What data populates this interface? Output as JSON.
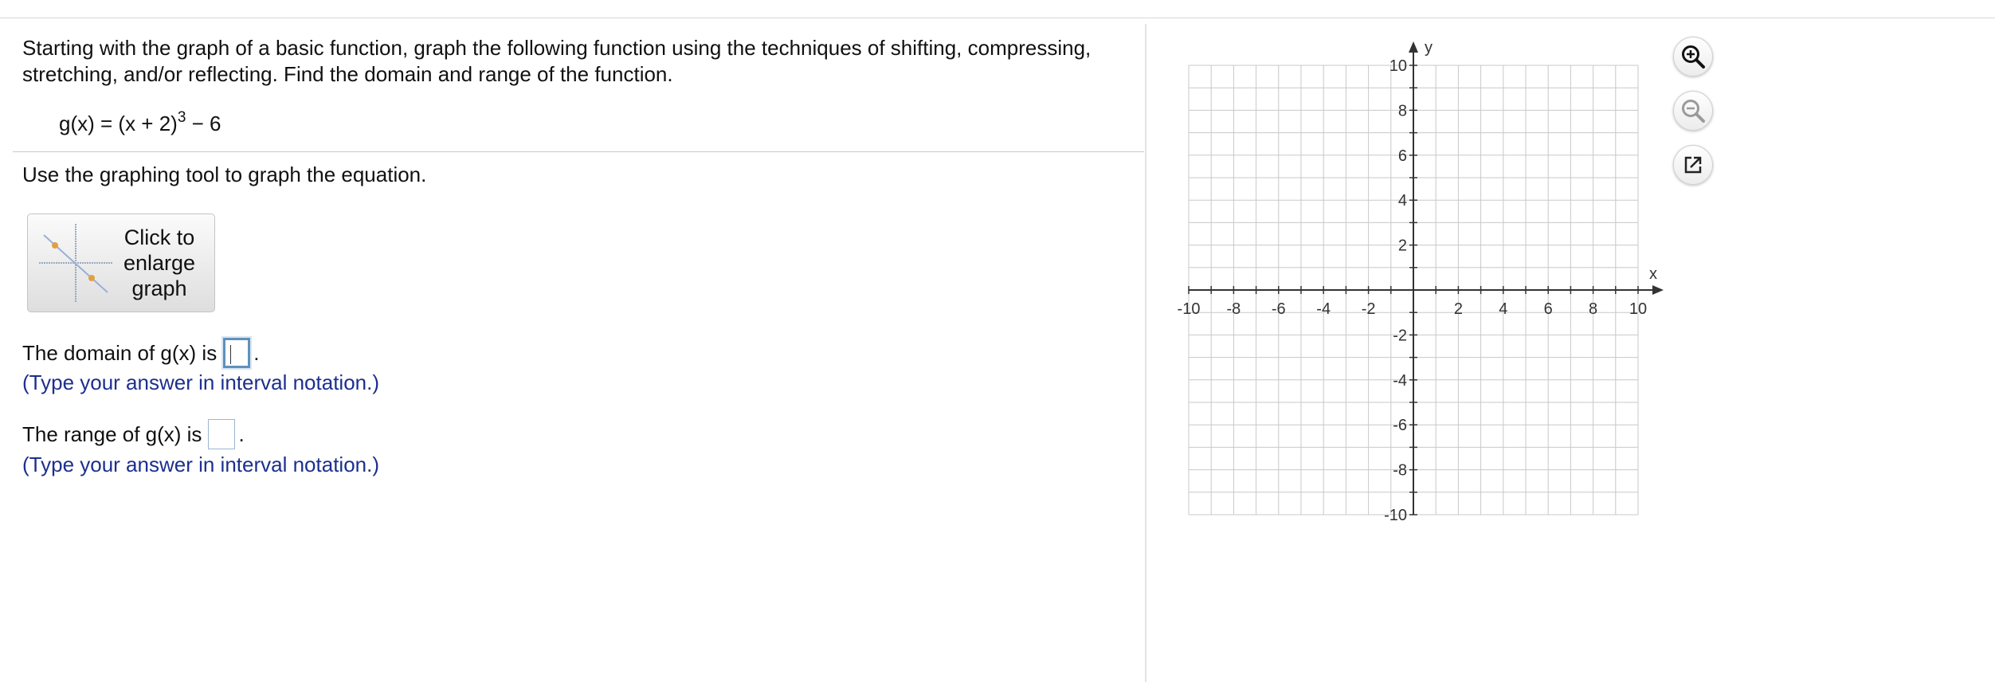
{
  "question": {
    "text": "Starting with the graph of a basic function, graph the following function using the techniques of shifting, compressing, stretching, and/or reflecting. Find the domain and range of the function.",
    "equation_main": "g(x) = (x + 2)",
    "equation_exponent": "3",
    "equation_tail": " − 6"
  },
  "instruction": "Use the graphing tool to graph the equation.",
  "enlarge_button": {
    "label": "Click to enlarge graph"
  },
  "domain": {
    "label": "The domain of g(x) is",
    "value": "",
    "period": ".",
    "hint": "(Type your answer in interval notation.)"
  },
  "range": {
    "label": "The range of g(x) is",
    "value": "",
    "period": ".",
    "hint": "(Type your answer in interval notation.)"
  },
  "graph": {
    "x_label": "x",
    "y_label": "y",
    "x_range": [
      -10,
      10
    ],
    "y_range": [
      -10,
      10
    ],
    "grid_step": 1,
    "x_tick_labels": [
      "-10",
      "-8",
      "-6",
      "-4",
      "-2",
      "2",
      "4",
      "6",
      "8",
      "10"
    ],
    "x_tick_values": [
      -10,
      -8,
      -6,
      -4,
      -2,
      2,
      4,
      6,
      8,
      10
    ],
    "y_tick_labels": [
      "10",
      "8",
      "6",
      "4",
      "2",
      "-2",
      "-4",
      "-6",
      "-8",
      "-10"
    ],
    "y_tick_values": [
      10,
      8,
      6,
      4,
      2,
      -2,
      -4,
      -6,
      -8,
      -10
    ],
    "grid_color": "#c8c8c8",
    "axis_color": "#333333"
  },
  "tools": [
    {
      "name": "zoom-in-icon"
    },
    {
      "name": "zoom-out-icon"
    },
    {
      "name": "popout-icon"
    }
  ]
}
